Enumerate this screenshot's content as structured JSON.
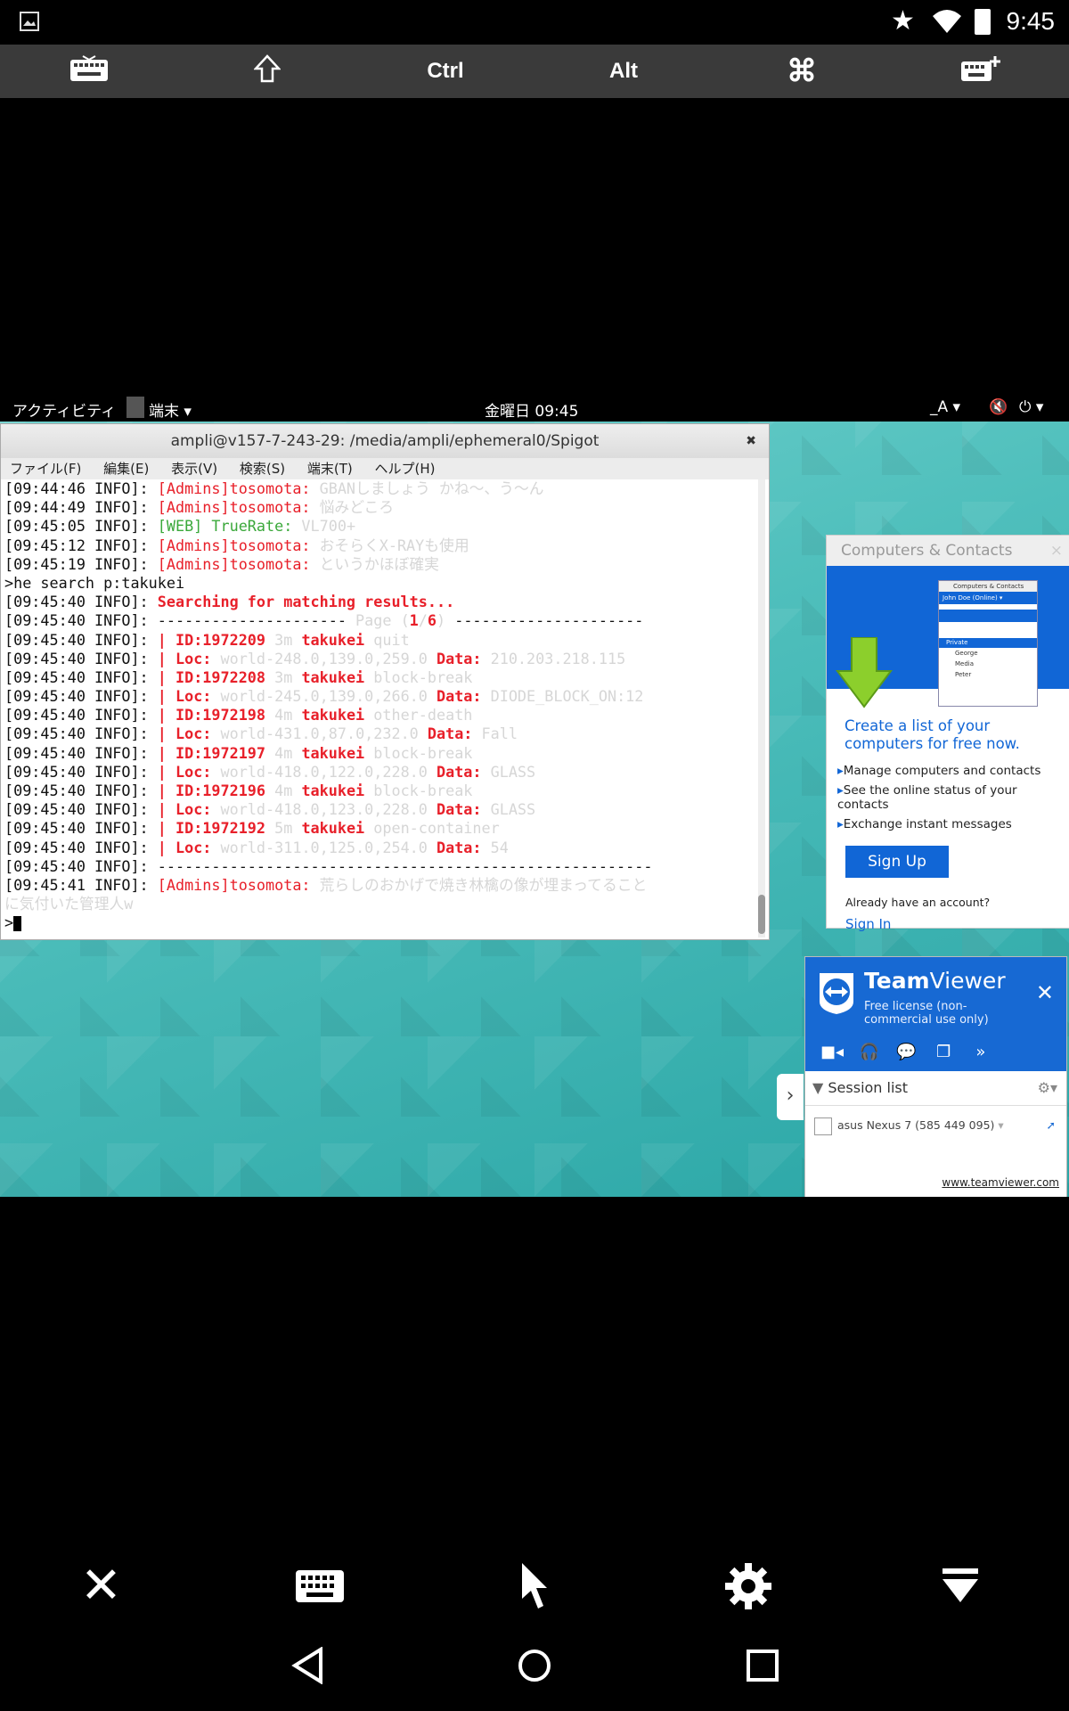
{
  "status_bar": {
    "time": "9:45"
  },
  "toolbar": {
    "ctrl": "Ctrl",
    "alt": "Alt"
  },
  "gnome": {
    "activities": "アクティビティ",
    "app_menu": "端末 ▾",
    "clock": "金曜日 09:45",
    "input": "_A ▾"
  },
  "terminal": {
    "title": "ampli@v157-7-243-29: /media/ampli/ephemeral0/Spigot",
    "menu": [
      "ファイル(F)",
      "編集(E)",
      "表示(V)",
      "検索(S)",
      "端末(T)",
      "ヘルプ(H)"
    ],
    "lines": [
      {
        "p": "[09:44:46 INFO]: ",
        "segs": [
          {
            "t": "[Admins]tosomota: ",
            "c": "redn"
          },
          {
            "t": "GBANしましょう かね～、う～ん",
            "c": "faint"
          }
        ]
      },
      {
        "p": "[09:44:49 INFO]: ",
        "segs": [
          {
            "t": "[Admins]tosomota: ",
            "c": "redn"
          },
          {
            "t": "悩みどころ",
            "c": "faint"
          }
        ]
      },
      {
        "p": "[09:45:05 INFO]: ",
        "segs": [
          {
            "t": "[WEB] TrueRate: ",
            "c": "grn"
          },
          {
            "t": "VL700+",
            "c": "faint"
          }
        ]
      },
      {
        "p": "[09:45:12 INFO]: ",
        "segs": [
          {
            "t": "[Admins]tosomota: ",
            "c": "redn"
          },
          {
            "t": "おそらくX-RAYも使用",
            "c": "faint"
          }
        ]
      },
      {
        "p": "[09:45:19 INFO]: ",
        "segs": [
          {
            "t": "[Admins]tosomota: ",
            "c": "redn"
          },
          {
            "t": "というかほぼ確実",
            "c": "faint"
          }
        ]
      },
      {
        "p": ">he search p:takukei",
        "segs": []
      },
      {
        "p": "[09:45:40 INFO]: ",
        "segs": [
          {
            "t": "Searching for matching results...",
            "c": "red"
          }
        ]
      },
      {
        "p": "[09:45:40 INFO]: ",
        "segs": [
          {
            "t": "--------------------- ",
            "c": ""
          },
          {
            "t": "Page (",
            "c": "faint"
          },
          {
            "t": "1",
            "c": "red"
          },
          {
            "t": "/",
            "c": "faint"
          },
          {
            "t": "6",
            "c": "red"
          },
          {
            "t": ")",
            "c": "faint"
          },
          {
            "t": " ---------------------",
            "c": ""
          }
        ]
      },
      {
        "p": "[09:45:40 INFO]: ",
        "segs": [
          {
            "t": "| ",
            "c": "red"
          },
          {
            "t": "ID:1972209 ",
            "c": "red"
          },
          {
            "t": "3m ",
            "c": "faint"
          },
          {
            "t": "takukei ",
            "c": "red"
          },
          {
            "t": "quit",
            "c": "faint"
          }
        ]
      },
      {
        "p": "[09:45:40 INFO]: ",
        "segs": [
          {
            "t": "| ",
            "c": "red"
          },
          {
            "t": "Loc: ",
            "c": "red"
          },
          {
            "t": "world-248.0,139.0,259.0 ",
            "c": "faint"
          },
          {
            "t": "Data: ",
            "c": "red"
          },
          {
            "t": "210.203.218.115",
            "c": "faint"
          }
        ]
      },
      {
        "p": "[09:45:40 INFO]: ",
        "segs": [
          {
            "t": "| ",
            "c": "red"
          },
          {
            "t": "ID:1972208 ",
            "c": "red"
          },
          {
            "t": "3m ",
            "c": "faint"
          },
          {
            "t": "takukei ",
            "c": "red"
          },
          {
            "t": "block-break",
            "c": "faint"
          }
        ]
      },
      {
        "p": "[09:45:40 INFO]: ",
        "segs": [
          {
            "t": "| ",
            "c": "red"
          },
          {
            "t": "Loc: ",
            "c": "red"
          },
          {
            "t": "world-245.0,139.0,266.0 ",
            "c": "faint"
          },
          {
            "t": "Data: ",
            "c": "red"
          },
          {
            "t": "DIODE_BLOCK_ON:12",
            "c": "faint"
          }
        ]
      },
      {
        "p": "[09:45:40 INFO]: ",
        "segs": [
          {
            "t": "| ",
            "c": "red"
          },
          {
            "t": "ID:1972198 ",
            "c": "red"
          },
          {
            "t": "4m ",
            "c": "faint"
          },
          {
            "t": "takukei ",
            "c": "red"
          },
          {
            "t": "other-death",
            "c": "faint"
          }
        ]
      },
      {
        "p": "[09:45:40 INFO]: ",
        "segs": [
          {
            "t": "| ",
            "c": "red"
          },
          {
            "t": "Loc: ",
            "c": "red"
          },
          {
            "t": "world-431.0,87.0,232.0 ",
            "c": "faint"
          },
          {
            "t": "Data: ",
            "c": "red"
          },
          {
            "t": "Fall",
            "c": "faint"
          }
        ]
      },
      {
        "p": "[09:45:40 INFO]: ",
        "segs": [
          {
            "t": "| ",
            "c": "red"
          },
          {
            "t": "ID:1972197 ",
            "c": "red"
          },
          {
            "t": "4m ",
            "c": "faint"
          },
          {
            "t": "takukei ",
            "c": "red"
          },
          {
            "t": "block-break",
            "c": "faint"
          }
        ]
      },
      {
        "p": "[09:45:40 INFO]: ",
        "segs": [
          {
            "t": "| ",
            "c": "red"
          },
          {
            "t": "Loc: ",
            "c": "red"
          },
          {
            "t": "world-418.0,122.0,228.0 ",
            "c": "faint"
          },
          {
            "t": "Data: ",
            "c": "red"
          },
          {
            "t": "GLASS",
            "c": "faint"
          }
        ]
      },
      {
        "p": "[09:45:40 INFO]: ",
        "segs": [
          {
            "t": "| ",
            "c": "red"
          },
          {
            "t": "ID:1972196 ",
            "c": "red"
          },
          {
            "t": "4m ",
            "c": "faint"
          },
          {
            "t": "takukei ",
            "c": "red"
          },
          {
            "t": "block-break",
            "c": "faint"
          }
        ]
      },
      {
        "p": "[09:45:40 INFO]: ",
        "segs": [
          {
            "t": "| ",
            "c": "red"
          },
          {
            "t": "Loc: ",
            "c": "red"
          },
          {
            "t": "world-418.0,123.0,228.0 ",
            "c": "faint"
          },
          {
            "t": "Data: ",
            "c": "red"
          },
          {
            "t": "GLASS",
            "c": "faint"
          }
        ]
      },
      {
        "p": "[09:45:40 INFO]: ",
        "segs": [
          {
            "t": "| ",
            "c": "red"
          },
          {
            "t": "ID:1972192 ",
            "c": "red"
          },
          {
            "t": "5m ",
            "c": "faint"
          },
          {
            "t": "takukei ",
            "c": "red"
          },
          {
            "t": "open-container",
            "c": "faint"
          }
        ]
      },
      {
        "p": "[09:45:40 INFO]: ",
        "segs": [
          {
            "t": "| ",
            "c": "red"
          },
          {
            "t": "Loc: ",
            "c": "red"
          },
          {
            "t": "world-311.0,125.0,254.0 ",
            "c": "faint"
          },
          {
            "t": "Data: ",
            "c": "red"
          },
          {
            "t": "54",
            "c": "faint"
          }
        ]
      },
      {
        "p": "[09:45:40 INFO]: ",
        "segs": [
          {
            "t": "-------------------------------------------------------",
            "c": ""
          }
        ]
      },
      {
        "p": "[09:45:41 INFO]: ",
        "segs": [
          {
            "t": "[Admins]tosomota: ",
            "c": "redn"
          },
          {
            "t": "荒らしのおかげで焼き林檎の像が埋まってること",
            "c": "faint"
          }
        ]
      },
      {
        "p": "",
        "segs": [
          {
            "t": "に気付いた管理人w",
            "c": "faint"
          }
        ]
      },
      {
        "p": ">",
        "segs": []
      }
    ]
  },
  "computers_contacts": {
    "header": "Computers & Contacts",
    "headline": "Create a list of your computers for free now.",
    "bullets": [
      "Manage computers and contacts",
      "See the online status of your contacts",
      "Exchange instant messages"
    ],
    "signup": "Sign Up",
    "already": "Already have an account?",
    "signin": "Sign In",
    "mini": {
      "title": "Computers & Contacts",
      "user": "John Doe (Online) ▾",
      "group": "Private",
      "names": [
        "George",
        "Media",
        "Peter"
      ]
    }
  },
  "teamviewer": {
    "brand_a": "Team",
    "brand_b": "Viewer",
    "license": "Free license (non-commercial use only)",
    "session_list": "Session list",
    "device": "asus Nexus 7 (585 449 095)",
    "link": "www.teamviewer.com"
  }
}
